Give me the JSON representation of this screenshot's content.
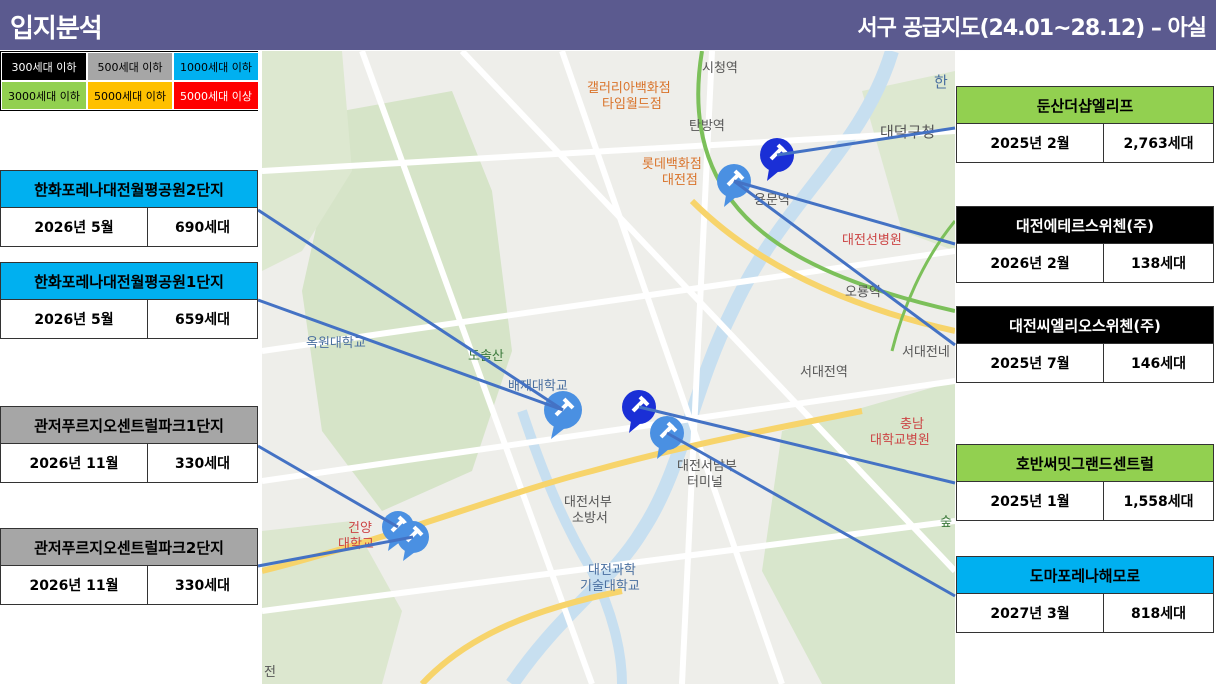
{
  "header": {
    "left": "입지분석",
    "right": "서구 공급지도(24.01~28.12) – 아실"
  },
  "legend": [
    {
      "label": "300세대 이하",
      "bg": "#000000",
      "fg": "#ffffff"
    },
    {
      "label": "500세대 이하",
      "bg": "#a6a6a6",
      "fg": "#000000"
    },
    {
      "label": "1000세대 이하",
      "bg": "#00b0f0",
      "fg": "#000000"
    },
    {
      "label": "3000세대 이하",
      "bg": "#92d050",
      "fg": "#000000"
    },
    {
      "label": "5000세대 이하",
      "bg": "#ffc000",
      "fg": "#000000"
    },
    {
      "label": "5000세대 이상",
      "bg": "#ff0000",
      "fg": "#ffffff"
    }
  ],
  "projects": [
    {
      "name": "한화포레나대전월평공원2단지",
      "date": "2026년 5월",
      "units": "690세대",
      "color": "#00b0f0",
      "fg": "#000000"
    },
    {
      "name": "한화포레나대전월평공원1단지",
      "date": "2026년 5월",
      "units": "659세대",
      "color": "#00b0f0",
      "fg": "#000000"
    },
    {
      "name": "관저푸르지오센트럴파크1단지",
      "date": "2026년 11월",
      "units": "330세대",
      "color": "#a6a6a6",
      "fg": "#000000"
    },
    {
      "name": "관저푸르지오센트럴파크2단지",
      "date": "2026년 11월",
      "units": "330세대",
      "color": "#a6a6a6",
      "fg": "#000000"
    },
    {
      "name": "둔산더샵엘리프",
      "date": "2025년 2월",
      "units": "2,763세대",
      "color": "#92d050",
      "fg": "#000000"
    },
    {
      "name": "대전에테르스위첸(주)",
      "date": "2026년 2월",
      "units": "138세대",
      "color": "#000000",
      "fg": "#ffffff"
    },
    {
      "name": "대전씨엘리오스위첸(주)",
      "date": "2025년 7월",
      "units": "146세대",
      "color": "#000000",
      "fg": "#ffffff"
    },
    {
      "name": "호반써밋그랜드센트럴",
      "date": "2025년 1월",
      "units": "1,558세대",
      "color": "#92d050",
      "fg": "#000000"
    },
    {
      "name": "도마포레나해모로",
      "date": "2027년 3월",
      "units": "818세대",
      "color": "#00b0f0",
      "fg": "#000000"
    }
  ],
  "map_labels": [
    {
      "text": "시청역",
      "cls": ""
    },
    {
      "text": "갤러리아백화점",
      "cls": "orange"
    },
    {
      "text": "타임월드점",
      "cls": "orange"
    },
    {
      "text": "탄방역",
      "cls": ""
    },
    {
      "text": "롯데백화점",
      "cls": "orange"
    },
    {
      "text": "대전점",
      "cls": "orange"
    },
    {
      "text": "용문역",
      "cls": ""
    },
    {
      "text": "대덕구청",
      "cls": ""
    },
    {
      "text": "대전선병원",
      "cls": "red"
    },
    {
      "text": "오룡역",
      "cls": ""
    },
    {
      "text": "서대전네",
      "cls": ""
    },
    {
      "text": "서대전역",
      "cls": ""
    },
    {
      "text": "옥원대학교",
      "cls": "blue"
    },
    {
      "text": "도솔산",
      "cls": "green"
    },
    {
      "text": "배재대학교",
      "cls": "blue"
    },
    {
      "text": "충남",
      "cls": "red"
    },
    {
      "text": "대학교병원",
      "cls": "red"
    },
    {
      "text": "대전서남부",
      "cls": ""
    },
    {
      "text": "터미널",
      "cls": ""
    },
    {
      "text": "대전서부",
      "cls": ""
    },
    {
      "text": "소방서",
      "cls": ""
    },
    {
      "text": "건양",
      "cls": "red"
    },
    {
      "text": "대학교",
      "cls": "red"
    },
    {
      "text": "대전과학",
      "cls": "blue"
    },
    {
      "text": "기술대학교",
      "cls": "blue"
    },
    {
      "text": "한",
      "cls": "blue"
    },
    {
      "text": "숲",
      "cls": "green"
    },
    {
      "text": "전",
      "cls": ""
    }
  ],
  "pins": [
    {
      "name": "dunsan-pin",
      "color": "#1a2fd6"
    },
    {
      "name": "yongmun-pin",
      "color": "#4a90e2"
    },
    {
      "name": "wolpyeong-pin",
      "color": "#4a90e2"
    },
    {
      "name": "homan-pin",
      "color": "#1a2fd6"
    },
    {
      "name": "doma-pin",
      "color": "#4a90e2"
    },
    {
      "name": "gwanjeo-pin-1",
      "color": "#4a90e2"
    },
    {
      "name": "gwanjeo-pin-2",
      "color": "#4a90e2"
    }
  ]
}
